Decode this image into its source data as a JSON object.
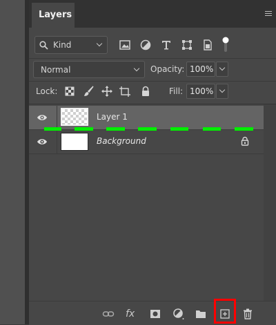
{
  "panel": {
    "tab_label": "Layers"
  },
  "filter": {
    "kind_label": "Kind",
    "icons": [
      "image-filter-icon",
      "adjustment-filter-icon",
      "type-filter-icon",
      "shape-filter-icon",
      "smart-object-filter-icon",
      "filter-toggle"
    ]
  },
  "blend": {
    "mode": "Normal",
    "opacity_label": "Opacity:",
    "opacity_value": "100%"
  },
  "lock": {
    "label": "Lock:",
    "icons": [
      "lock-transparent-pixels-icon",
      "lock-image-pixels-icon",
      "lock-position-icon",
      "lock-artboard-icon",
      "lock-all-icon"
    ],
    "fill_label": "Fill:",
    "fill_value": "100%"
  },
  "layers": [
    {
      "name": "Layer 1",
      "visible": true,
      "selected": true,
      "thumbnail": "transparent"
    },
    {
      "name": "Background",
      "visible": true,
      "selected": false,
      "locked": true,
      "thumbnail": "white"
    }
  ],
  "bottom_toolbar": {
    "buttons": [
      "link-layers-icon",
      "fx-icon",
      "layer-mask-icon",
      "adjustment-layer-icon",
      "group-folder-icon",
      "new-layer-icon",
      "delete-icon"
    ],
    "fx_label": "fx",
    "highlighted": "new-layer-icon"
  },
  "colors": {
    "highlight_box": "#ff0000",
    "dash_marker": "#00ee00",
    "selected_row": "#646464"
  }
}
